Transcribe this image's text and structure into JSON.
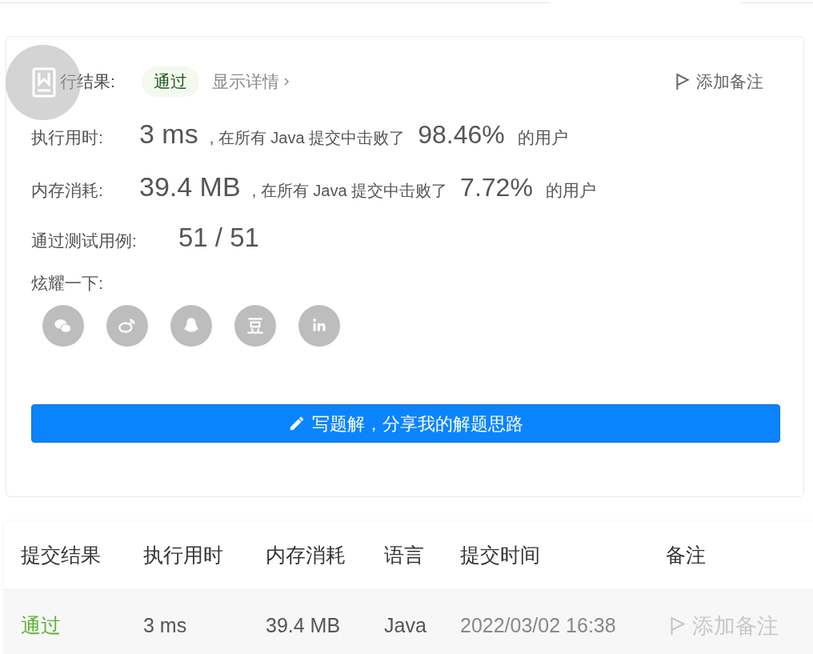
{
  "result": {
    "label": "行结果:",
    "status": "通过",
    "details_link": "显示详情",
    "add_note": "添加备注"
  },
  "stats": [
    {
      "label": "执行用时:",
      "value": "3 ms",
      "middle": ", 在所有 Java 提交中击败了",
      "percent": "98.46%",
      "suffix": "的用户"
    },
    {
      "label": "内存消耗:",
      "value": "39.4 MB",
      "middle": ", 在所有 Java 提交中击败了",
      "percent": "7.72%",
      "suffix": "的用户"
    }
  ],
  "tests": {
    "label": "通过测试用例:",
    "value": "51 / 51"
  },
  "share": {
    "label": "炫耀一下:",
    "icons": [
      {
        "kind": "wechat"
      },
      {
        "kind": "weibo"
      },
      {
        "kind": "qq"
      },
      {
        "kind": "douban"
      },
      {
        "kind": "linkedin"
      }
    ]
  },
  "write_button": "写题解，分享我的解题思路",
  "table": {
    "columns": [
      "提交结果",
      "执行用时",
      "内存消耗",
      "语言",
      "提交时间",
      "备注"
    ],
    "rows": [
      {
        "status": "通过",
        "time": "3 ms",
        "memory": "39.4 MB",
        "language": "Java",
        "submitted": "2022/03/02 16:38",
        "note": "添加备注"
      }
    ]
  }
}
